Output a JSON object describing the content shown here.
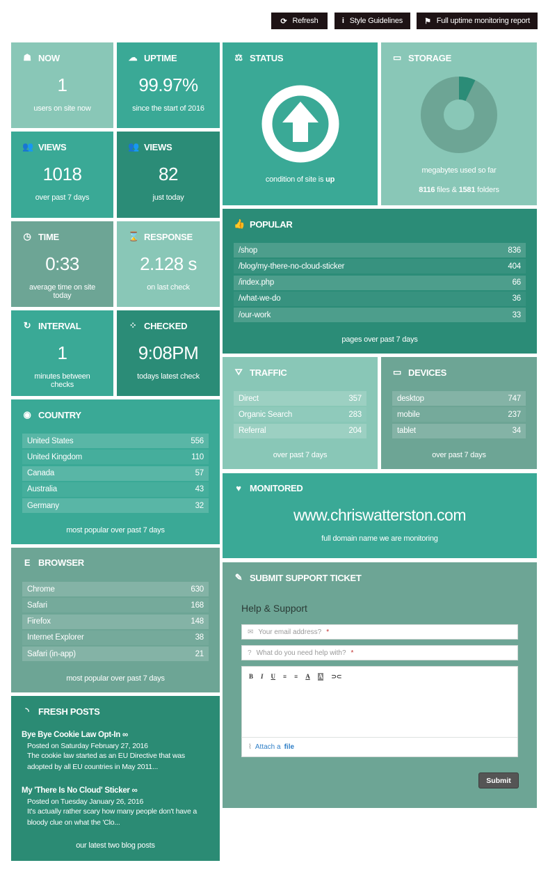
{
  "top_buttons": {
    "refresh": "Refresh",
    "style": "Style Guidelines",
    "report": "Full uptime monitoring report"
  },
  "now": {
    "title": "NOW",
    "value": "1",
    "sub": "users on site now"
  },
  "uptime": {
    "title": "UPTIME",
    "value": "99.97%",
    "sub": "since the start of 2016"
  },
  "views_week": {
    "title": "VIEWS",
    "value": "1018",
    "sub": "over past 7 days"
  },
  "views_today": {
    "title": "VIEWS",
    "value": "82",
    "sub": "just today"
  },
  "time": {
    "title": "TIME",
    "value": "0:33",
    "sub": "average time on site today"
  },
  "response": {
    "title": "RESPONSE",
    "value": "2.128 s",
    "sub": "on last check"
  },
  "interval": {
    "title": "INTERVAL",
    "value": "1",
    "sub": "minutes between checks"
  },
  "checked": {
    "title": "CHECKED",
    "value": "9:08PM",
    "sub": "todays latest check"
  },
  "status": {
    "title": "STATUS",
    "sub_prefix": "condition of site is",
    "state": "up"
  },
  "storage": {
    "title": "STORAGE",
    "sub": "megabytes used so far",
    "files": "8116",
    "files_label": "files &",
    "folders": "1581",
    "folders_label": "folders",
    "used_fraction": 0.07
  },
  "popular": {
    "title": "POPULAR",
    "rows": [
      {
        "label": "/shop",
        "value": "836"
      },
      {
        "label": "/blog/my-there-no-cloud-sticker",
        "value": "404"
      },
      {
        "label": "/index.php",
        "value": "66"
      },
      {
        "label": "/what-we-do",
        "value": "36"
      },
      {
        "label": "/our-work",
        "value": "33"
      }
    ],
    "sub": "pages over past 7 days"
  },
  "traffic": {
    "title": "TRAFFIC",
    "rows": [
      {
        "label": "Direct",
        "value": "357"
      },
      {
        "label": "Organic Search",
        "value": "283"
      },
      {
        "label": "Referral",
        "value": "204"
      }
    ],
    "sub": "over past 7 days"
  },
  "devices": {
    "title": "DEVICES",
    "rows": [
      {
        "label": "desktop",
        "value": "747"
      },
      {
        "label": "mobile",
        "value": "237"
      },
      {
        "label": "tablet",
        "value": "34"
      }
    ],
    "sub": "over past 7 days"
  },
  "country": {
    "title": "COUNTRY",
    "rows": [
      {
        "label": "United States",
        "value": "556"
      },
      {
        "label": "United Kingdom",
        "value": "110"
      },
      {
        "label": "Canada",
        "value": "57"
      },
      {
        "label": "Australia",
        "value": "43"
      },
      {
        "label": "Germany",
        "value": "32"
      }
    ],
    "sub": "most popular over past 7 days"
  },
  "monitored": {
    "title": "MONITORED",
    "domain": "www.chriswatterston.com",
    "sub": "full domain name we are monitoring"
  },
  "browser": {
    "title": "BROWSER",
    "rows": [
      {
        "label": "Chrome",
        "value": "630"
      },
      {
        "label": "Safari",
        "value": "168"
      },
      {
        "label": "Firefox",
        "value": "148"
      },
      {
        "label": "Internet Explorer",
        "value": "38"
      },
      {
        "label": "Safari (in-app)",
        "value": "21"
      }
    ],
    "sub": "most popular over past 7 days"
  },
  "support": {
    "title": "SUBMIT SUPPORT TICKET",
    "heading": "Help & Support",
    "email_placeholder": "Your email address?",
    "help_placeholder": "What do you need help with?",
    "required": "*",
    "toolbar": [
      "B",
      "I",
      "U",
      "≡",
      "≡",
      "A",
      "A",
      "⊃⊂"
    ],
    "attach_prefix": "Attach a",
    "attach_link": "file",
    "submit": "Submit"
  },
  "posts": {
    "title": "FRESH POSTS",
    "items": [
      {
        "title": "Bye Bye Cookie Law Opt-In",
        "date": "Posted on Saturday February 27, 2016",
        "excerpt": "The cookie law started as an EU Directive that was adopted by all EU countries in May 2011..."
      },
      {
        "title": "My 'There Is No Cloud' Sticker",
        "date": "Posted on Tuesday January 26, 2016",
        "excerpt": "It's actually rather scary how many people don't have a bloody clue on what the 'Clo..."
      }
    ],
    "sub": "our latest two blog posts"
  },
  "colors": {
    "light": "#89c7b7",
    "mid": "#3aa996",
    "dark": "#2b8c77",
    "grey": "#6da595",
    "button_bg": "#1e1315"
  }
}
